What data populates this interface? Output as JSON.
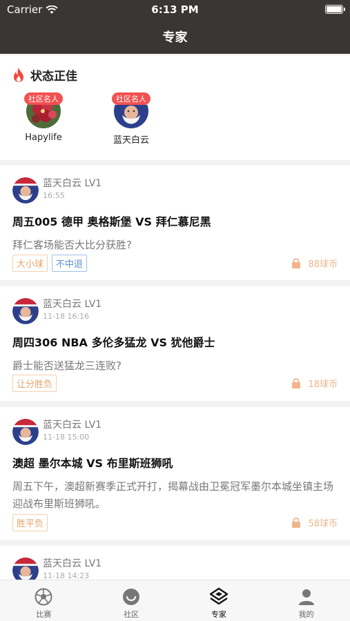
{
  "status_bar": {
    "carrier": "Carrier",
    "time": "6:13 PM"
  },
  "nav": {
    "title": "专家"
  },
  "hot": {
    "title": "状态正佳",
    "experts": [
      {
        "badge": "社区名人",
        "name": "Hapylife",
        "avatar": "flower-avatar"
      },
      {
        "badge": "社区名人",
        "name": "蓝天白云",
        "avatar": "santa-avatar"
      }
    ]
  },
  "posts": [
    {
      "author": "蓝天白云 LV1",
      "date": "16:55",
      "match": "周五005 德甲 奥格斯堡 VS 拜仁慕尼黑",
      "desc": "拜仁客场能否大比分获胜?",
      "tags": [
        {
          "label": "大小球",
          "color": "orange"
        },
        {
          "label": "不中退",
          "color": "blue"
        }
      ],
      "price": "88球币"
    },
    {
      "author": "蓝天白云 LV1",
      "date": "11-18 16:16",
      "match": "周四306 NBA 多伦多猛龙 VS 犹他爵士",
      "desc": "爵士能否送猛龙三连败?",
      "tags": [
        {
          "label": "让分胜负",
          "color": "orange"
        }
      ],
      "price": "18球币"
    },
    {
      "author": "蓝天白云 LV1",
      "date": "11-18 15:00",
      "match": " 澳超 墨尔本城 VS 布里斯班狮吼",
      "desc": "周五下午，澳超新赛季正式开打，揭幕战由卫冕冠军墨尔本城坐镇主场迎战布里斯班狮吼。",
      "tags": [
        {
          "label": "胜平负",
          "color": "orange"
        }
      ],
      "price": "58球币"
    },
    {
      "author": "蓝天白云 LV1",
      "date": "11-18 14:23",
      "match": "",
      "desc": "",
      "tags": [],
      "price": ""
    }
  ],
  "tabbar": {
    "tabs": [
      {
        "label": "比赛",
        "icon": "soccer-ball-icon"
      },
      {
        "label": "社区",
        "icon": "community-icon"
      },
      {
        "label": "专家",
        "icon": "expert-icon",
        "active": true
      },
      {
        "label": "我的",
        "icon": "person-icon"
      }
    ]
  },
  "colors": {
    "header": "#3a3633",
    "badge": "#f25151",
    "flame": "#f04a3a",
    "price": "#f0b58a",
    "accent_blue": "#5b8fd6"
  }
}
